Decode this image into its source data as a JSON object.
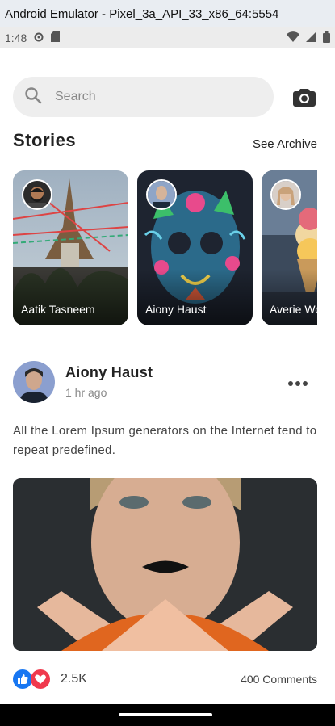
{
  "window": {
    "title": "Android Emulator - Pixel_3a_API_33_x86_64:5554"
  },
  "status_bar": {
    "time": "1:48"
  },
  "search": {
    "placeholder": "Search"
  },
  "stories": {
    "title": "Stories",
    "see_archive": "See Archive",
    "items": [
      {
        "name": "Aatik Tasneem"
      },
      {
        "name": "Aiony Haust"
      },
      {
        "name": "Averie Woodard"
      }
    ]
  },
  "post": {
    "author": "Aiony Haust",
    "time": "1 hr ago",
    "text": "All the Lorem Ipsum generators on the Internet tend to repeat predefined.",
    "reactions": "2.5K",
    "comments": "400 Comments"
  },
  "colors": {
    "like": "#1877f2",
    "love": "#f0394d",
    "search_bg": "#eeeeee"
  }
}
